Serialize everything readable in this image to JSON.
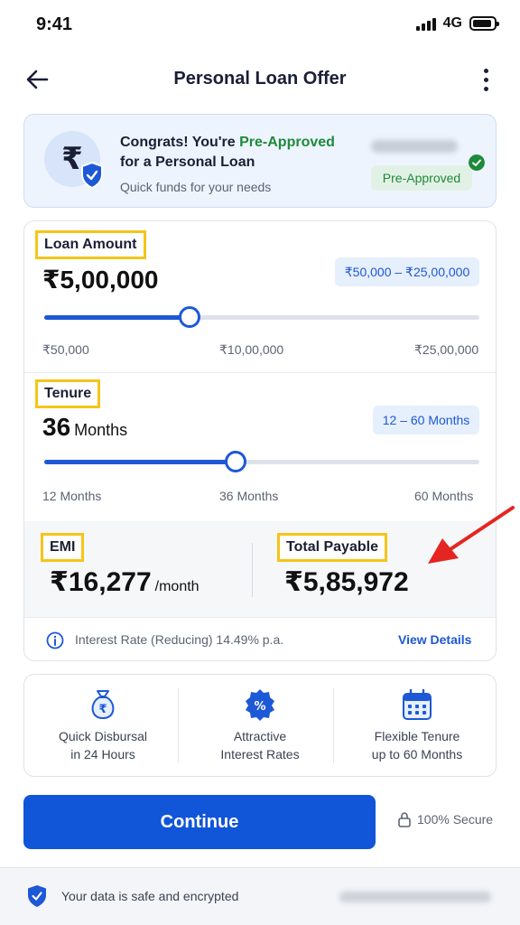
{
  "status": {
    "time": "9:41",
    "network": "4G"
  },
  "header": {
    "title": "Personal Loan Offer"
  },
  "offer": {
    "rupee_symbol": "₹",
    "line1_prefix": "Congrats! You're ",
    "line1_highlight": "Pre-Approved",
    "line2": "for a Personal Loan",
    "subtitle": "Quick funds for your needs",
    "badge": "Pre-Approved"
  },
  "loan_amount": {
    "label": "Loan Amount",
    "value": "₹5,00,000",
    "range": "₹50,000 – ₹25,00,000",
    "ticks": [
      "₹50,000",
      "₹10,00,000",
      "₹25,00,000"
    ],
    "slider_fraction": 0.333
  },
  "tenure": {
    "label": "Tenure",
    "value": "36",
    "unit": "Months",
    "range": "12 – 60 Months",
    "ticks": [
      "12 Months",
      "36 Months",
      "60 Months"
    ],
    "slider_fraction": 0.44
  },
  "emi": {
    "label": "EMI",
    "value": "₹16,277",
    "per": "/month"
  },
  "total": {
    "label": "Total Payable",
    "value": "₹5,85,972"
  },
  "info": {
    "text": "Interest Rate (Reducing) 14.49% p.a.",
    "link": "View Details"
  },
  "features": [
    {
      "icon": "money-bag-icon",
      "line1": "Quick Disbursal",
      "line2": "in 24 Hours"
    },
    {
      "icon": "percent-badge-icon",
      "line1": "Attractive",
      "line2": "Interest Rates"
    },
    {
      "icon": "calendar-icon",
      "line1": "Flexible Tenure",
      "line2": "up to 60 Months"
    }
  ],
  "actions": {
    "continue": "Continue",
    "secure": "100% Secure"
  },
  "footer": {
    "text": "Your data is safe and encrypted"
  },
  "colors": {
    "primary": "#1155d8",
    "success": "#1e8a3a",
    "highlight": "#f5c518",
    "arrow": "#e52521"
  }
}
